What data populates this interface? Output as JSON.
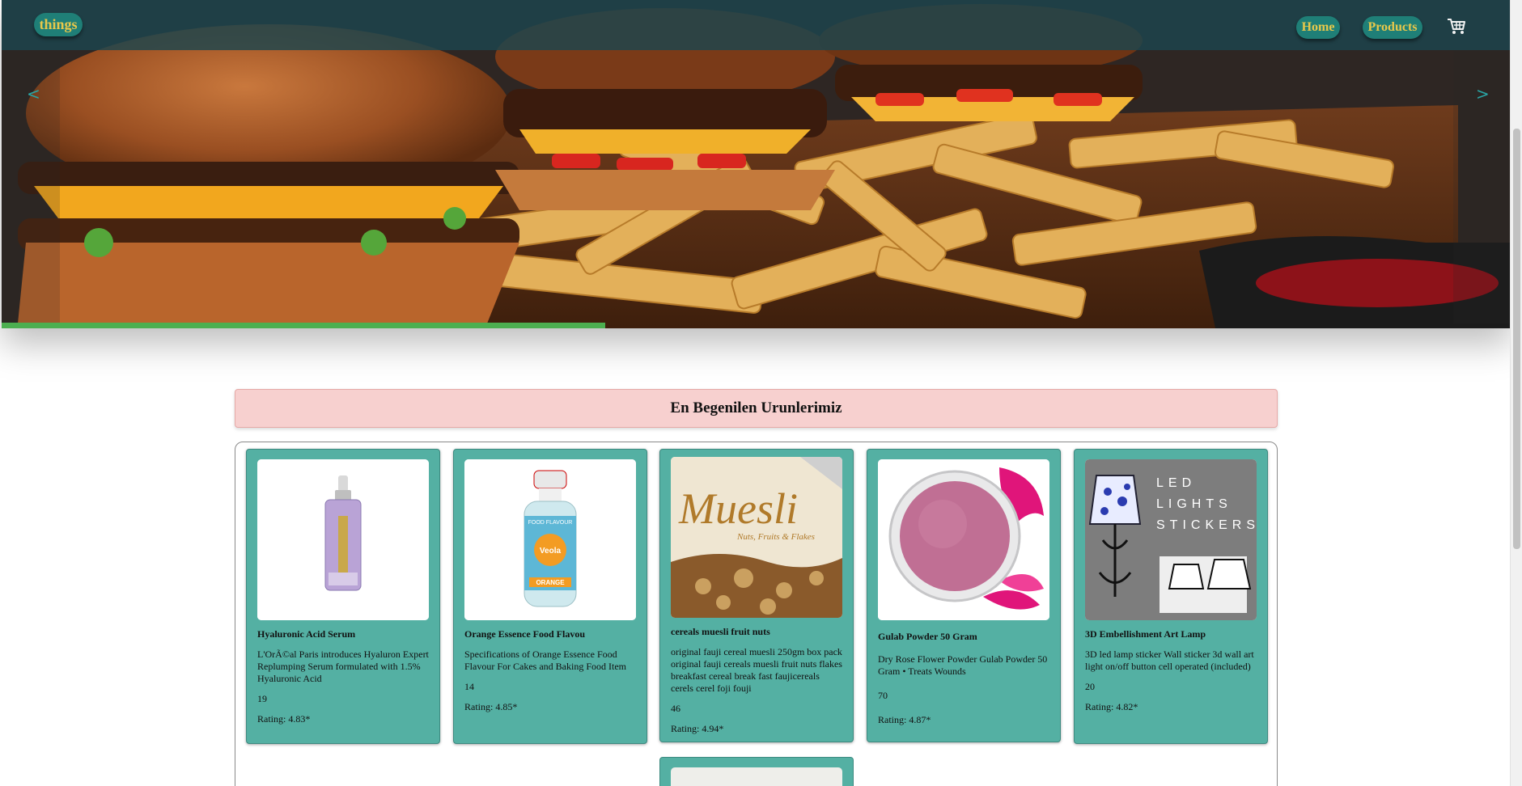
{
  "navbar": {
    "logo": "things",
    "links": [
      {
        "label": "Home"
      },
      {
        "label": "Products"
      }
    ],
    "cart_icon": "cart-icon"
  },
  "slider": {
    "prev_label": "<",
    "next_label": ">",
    "progress_fraction": 0.4
  },
  "section": {
    "title": "En Begenilen Urunlerimiz"
  },
  "products": [
    {
      "title": "Hyaluronic Acid Serum",
      "description": "L'OrÃ©al Paris introduces Hyaluron Expert Replumping Serum formulated with 1.5% Hyaluronic Acid",
      "price": "19",
      "rating": "Rating: 4.83*"
    },
    {
      "title": "Orange Essence Food Flavou",
      "description": "Specifications of Orange Essence Food Flavour For Cakes and Baking Food Item",
      "price": "14",
      "rating": "Rating: 4.85*"
    },
    {
      "title": "cereals muesli fruit nuts",
      "description": "original fauji cereal muesli 250gm box pack original fauji cereals muesli fruit nuts flakes breakfast cereal break fast faujicereals cerels cerel foji fouji",
      "price": "46",
      "rating": "Rating: 4.94*"
    },
    {
      "title": "Gulab Powder 50 Gram",
      "description": "Dry Rose Flower Powder Gulab Powder 50 Gram • Treats Wounds",
      "price": "70",
      "rating": "Rating: 4.87*"
    },
    {
      "title": "3D Embellishment Art Lamp",
      "description": "3D led lamp sticker Wall sticker 3d wall art light on/off button cell operated (included)",
      "price": "20",
      "rating": "Rating: 4.82*"
    }
  ],
  "image_text": {
    "muesli_brand": "Muesli",
    "muesli_sub": "Nuts, Fruits & Flakes",
    "orange_label_top": "FOOD FLAVOUR",
    "orange_label_brand": "Veola",
    "orange_label_bottom": "ORANGE",
    "lamp_line1": "LED",
    "lamp_line2": "LIGHTS",
    "lamp_line3": "STICKERS"
  },
  "colors": {
    "navbar": "#1c464e",
    "pill": "#1f7f77",
    "pill_text": "#e8c84a",
    "card": "#54b0a3",
    "section_bg": "#f7d0cf",
    "progress": "#4caf50"
  }
}
